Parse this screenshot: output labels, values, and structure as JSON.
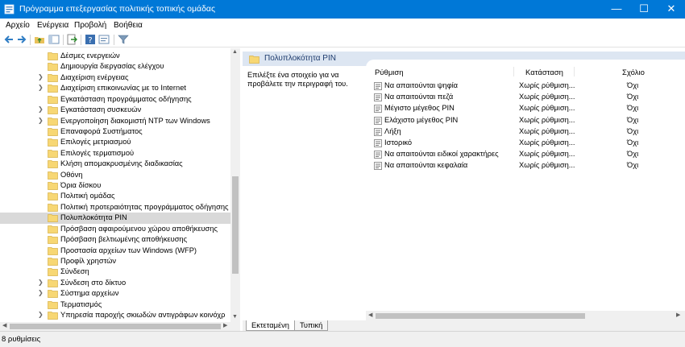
{
  "window": {
    "title": "Πρόγραμμα επεξεργασίας πολιτικής τοπικής ομάδας",
    "minimize_glyph": "—",
    "maximize_glyph": "☐",
    "close_glyph": "✕"
  },
  "menu": [
    "Αρχείο",
    "Ενέργεια",
    "Προβολή",
    "Βοήθεια"
  ],
  "toolbar": {
    "icons": [
      "back-arrow-icon",
      "forward-arrow-icon",
      "up-folder-icon",
      "show-hide-tree-icon",
      "export-list-icon",
      "help-icon",
      "properties-icon",
      "filter-icon"
    ]
  },
  "tree": {
    "items": [
      {
        "label": "Δέσμες ενεργειών",
        "expandable": false
      },
      {
        "label": "Δημιουργία διεργασίας ελέγχου",
        "expandable": false
      },
      {
        "label": "Διαχείριση ενέργειας",
        "expandable": true
      },
      {
        "label": "Διαχείριση επικοινωνίας με το Internet",
        "expandable": true
      },
      {
        "label": "Εγκατάσταση προγράμματος οδήγησης",
        "expandable": false
      },
      {
        "label": "Εγκατάσταση συσκευών",
        "expandable": true
      },
      {
        "label": "Ενεργοποίηση διακομιστή NTP των Windows",
        "expandable": true
      },
      {
        "label": "Επαναφορά Συστήματος",
        "expandable": false
      },
      {
        "label": "Επιλογές μετριασμού",
        "expandable": false
      },
      {
        "label": "Επιλογές τερματισμού",
        "expandable": false
      },
      {
        "label": "Κλήση απομακρυσμένης διαδικασίας",
        "expandable": false
      },
      {
        "label": "Οθόνη",
        "expandable": false
      },
      {
        "label": "Όρια δίσκου",
        "expandable": false
      },
      {
        "label": "Πολιτική ομάδας",
        "expandable": false
      },
      {
        "label": "Πολιτική προτεραιότητας προγράμματος οδήγησης α",
        "expandable": false
      },
      {
        "label": "Πολυπλοκότητα PIN",
        "expandable": false,
        "selected": true
      },
      {
        "label": "Πρόσβαση αφαιρούμενου χώρου αποθήκευσης",
        "expandable": false
      },
      {
        "label": "Πρόσβαση βελτιωμένης αποθήκευσης",
        "expandable": false
      },
      {
        "label": "Προστασία αρχείων των Windows (WFP)",
        "expandable": false
      },
      {
        "label": "Προφίλ χρηστών",
        "expandable": false
      },
      {
        "label": "Σύνδεση",
        "expandable": false
      },
      {
        "label": "Σύνδεση στο δίκτυο",
        "expandable": true
      },
      {
        "label": "Σύστημα αρχείων",
        "expandable": true
      },
      {
        "label": "Τερματισμός",
        "expandable": false
      },
      {
        "label": "Υπηρεσία παροχής σκιωδών αντιγράφων κοινόχρ",
        "expandable": true
      }
    ]
  },
  "right_pane": {
    "header": "Πολυπλοκότητα PIN",
    "description": "Επιλέξτε ένα στοιχείο για να προβάλετε την περιγραφή του.",
    "columns": {
      "setting": "Ρύθμιση",
      "state": "Κατάσταση",
      "comment": "Σχόλιο"
    },
    "rows": [
      {
        "setting": "Να απαιτούνται ψηφία",
        "state": "Χωρίς ρύθμιση...",
        "comment": "Όχι"
      },
      {
        "setting": "Να απαιτούνται πεζά",
        "state": "Χωρίς ρύθμιση...",
        "comment": "Όχι"
      },
      {
        "setting": "Μέγιστο μέγεθος PIN",
        "state": "Χωρίς ρύθμιση...",
        "comment": "Όχι"
      },
      {
        "setting": "Ελάχιστο μέγεθος PIN",
        "state": "Χωρίς ρύθμιση...",
        "comment": "Όχι"
      },
      {
        "setting": "Λήξη",
        "state": "Χωρίς ρύθμιση...",
        "comment": "Όχι"
      },
      {
        "setting": "Ιστορικό",
        "state": "Χωρίς ρύθμιση...",
        "comment": "Όχι"
      },
      {
        "setting": "Να απαιτούνται ειδικοί χαρακτήρες",
        "state": "Χωρίς ρύθμιση...",
        "comment": "Όχι"
      },
      {
        "setting": "Να απαιτούνται κεφαλαία",
        "state": "Χωρίς ρύθμιση...",
        "comment": "Όχι"
      }
    ],
    "tabs": [
      {
        "label": "Εκτεταμένη",
        "active": true
      },
      {
        "label": "Τυπική",
        "active": false
      }
    ]
  },
  "status": {
    "text": "8 ρυθμίσεις"
  },
  "colors": {
    "titlebar": "#0078d7",
    "folder": "#f7d774",
    "header_band": "#dde6f2"
  }
}
